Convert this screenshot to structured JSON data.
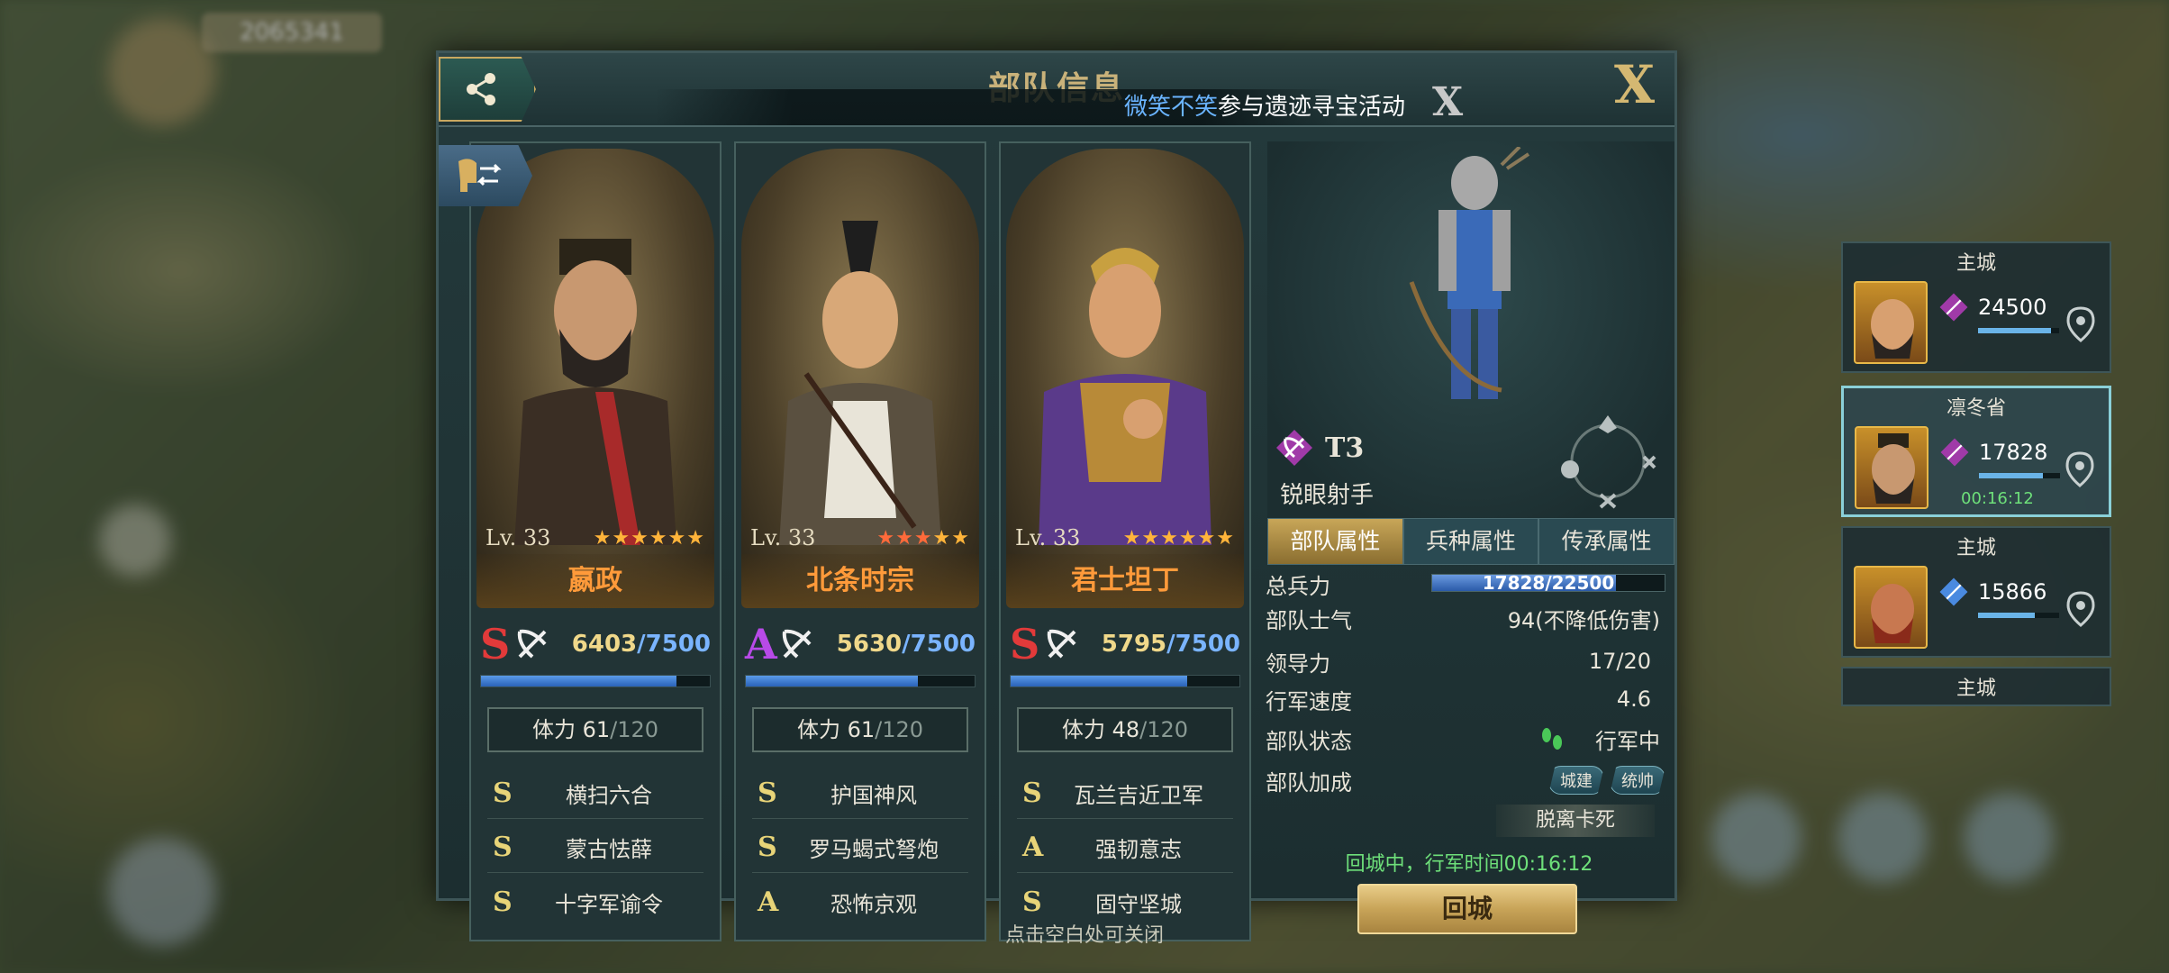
{
  "background": {
    "player_id": "2065341"
  },
  "panel": {
    "title": "部队信息",
    "marquee": {
      "user": "微笑不笑",
      "message": "参与遗迹寻宝活动"
    },
    "close_label": "X",
    "marquee_close": "X"
  },
  "commanders": [
    {
      "name": "嬴政",
      "level": "Lv. 33",
      "stars": 6,
      "red_stars": 0,
      "grade": "S",
      "power_current": "6403",
      "power_max": "/7500",
      "power_fraction": 0.854,
      "stamina_label": "体力 61",
      "stamina_max": "/120",
      "skills": [
        {
          "grade": "S",
          "name": "横扫六合"
        },
        {
          "grade": "S",
          "name": "蒙古怯薛"
        },
        {
          "grade": "S",
          "name": "十字军谕令"
        }
      ]
    },
    {
      "name": "北条时宗",
      "level": "Lv. 33",
      "stars": 5,
      "red_stars": 3,
      "grade": "A",
      "power_current": "5630",
      "power_max": "/7500",
      "power_fraction": 0.751,
      "stamina_label": "体力 61",
      "stamina_max": "/120",
      "skills": [
        {
          "grade": "S",
          "name": "护国神风"
        },
        {
          "grade": "S",
          "name": "罗马蝎式弩炮"
        },
        {
          "grade": "A",
          "name": "恐怖京观"
        }
      ]
    },
    {
      "name": "君士坦丁",
      "level": "Lv. 33",
      "stars": 6,
      "red_stars": 0,
      "grade": "S",
      "power_current": "5795",
      "power_max": "/7500",
      "power_fraction": 0.773,
      "stamina_label": "体力 48",
      "stamina_max": "/120",
      "skills": [
        {
          "grade": "S",
          "name": "瓦兰吉近卫军"
        },
        {
          "grade": "A",
          "name": "强韧意志"
        },
        {
          "grade": "S",
          "name": "固守坚城"
        }
      ]
    }
  ],
  "unit": {
    "tier": "T3",
    "name": "锐眼射手"
  },
  "tabs": [
    "部队属性",
    "兵种属性",
    "传承属性"
  ],
  "stats": {
    "troops_label": "总兵力",
    "troops_value": "17828/22500",
    "troops_fraction": 0.792,
    "morale_label": "部队士气",
    "morale_value": "94(不降低伤害)",
    "leadership_label": "领导力",
    "leadership_value": "17/20",
    "speed_label": "行军速度",
    "speed_value": "4.6",
    "status_label": "部队状态",
    "status_value": "行军中",
    "bonus_label": "部队加成",
    "bonus_tags": [
      "城建",
      "统帅"
    ]
  },
  "unstuck_label": "脱离卡死",
  "returning_text": "回城中，行军时间00:16:12",
  "return_button": "回城",
  "close_hint": "点击空白处可关闭",
  "armies": [
    {
      "location": "主城",
      "count": "24500",
      "fraction": 0.9,
      "selected": false,
      "timer": ""
    },
    {
      "location": "凛冬省",
      "count": "17828",
      "fraction": 0.79,
      "selected": true,
      "timer": "00:16:12"
    },
    {
      "location": "主城",
      "count": "15866",
      "fraction": 0.7,
      "selected": false,
      "timer": ""
    },
    {
      "location": "主城",
      "count": "",
      "fraction": 0,
      "selected": false,
      "timer": ""
    }
  ],
  "colors": {
    "accent_gold": "#c9b27a",
    "grade_s": "#e23a3a",
    "grade_a": "#b84ae8",
    "status_green": "#6ee07a",
    "name_orange": "#ff9a3a"
  }
}
